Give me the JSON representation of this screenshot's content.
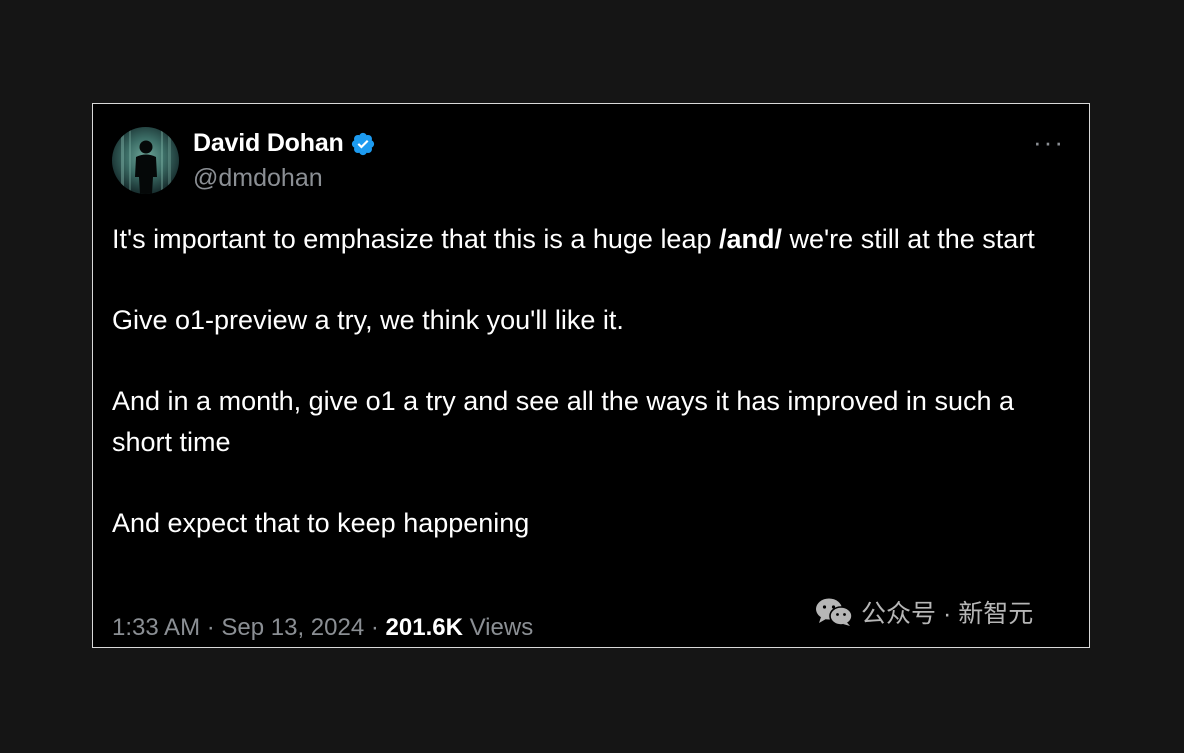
{
  "tweet": {
    "author": {
      "name": "David Dohan",
      "handle": "@dmdohan",
      "verified": true
    },
    "paragraphs": [
      {
        "before": "It's important to emphasize that this is a huge leap ",
        "bold": "/and/",
        "after": " we're still at the start"
      },
      {
        "text": "Give o1-preview a try, we think you'll like it."
      },
      {
        "text": "And in a month, give o1 a try and see all the ways it has improved in such a short time"
      },
      {
        "text": "And expect that to keep happening"
      }
    ],
    "time": "1:33 AM",
    "date": "Sep 13, 2024",
    "separator": "·",
    "views_count": "201.6K",
    "views_label": "Views",
    "more_label": "···"
  },
  "watermark": {
    "text": "公众号 · 新智元",
    "icon": "wechat-icon"
  },
  "colors": {
    "page_bg": "#151515",
    "card_bg": "#000000",
    "verified_blue": "#1d9bf0",
    "muted": "#8b8f94"
  }
}
